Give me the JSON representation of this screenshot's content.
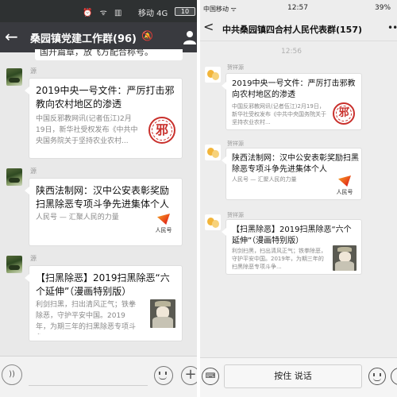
{
  "left": {
    "status": {
      "icons": "⏰ ᯤ ▥",
      "carrier": "移动 4G",
      "battery": "10"
    },
    "nav": {
      "back": "←",
      "title": "桑园镇党建工作群(96)",
      "mute": "🔕"
    },
    "cut_text": "国开篇章，放飞方配合称号。",
    "messages": [
      {
        "sender": "源",
        "title": "2019中央一号文件：严厉打击邪教向农村地区的渗透",
        "desc": "中国反邪教网讯(记者伍江)2月19日，新华社受权发布《中共中央国务院关于坚持农业农村...",
        "thumb": "seal",
        "thumb_text": "邪"
      },
      {
        "sender": "源",
        "title": "陕西法制网：汉中公安表彰奖励扫黑除恶专项斗争先进集体个人",
        "desc": "人民号 — 汇聚人民的力量",
        "thumb": "rmh",
        "thumb_text": "人民号"
      },
      {
        "sender": "源",
        "title": "【扫黑除恶】2019扫黑除恶“六个延伸”（漫画特别版）",
        "desc": "利剑扫黑，扫出清风正气；铁拳除恶，守护平安中国。2019年，为期三年的扫黑除恶专项斗争...",
        "thumb": "comic"
      }
    ],
    "bottom": {
      "voice": "))"
    }
  },
  "right": {
    "status": {
      "carrier": "中国移动 ᯤ",
      "time": "12:57",
      "battery": "39%"
    },
    "nav": {
      "back": "<",
      "title": "中共桑园镇四合村人民代表群(157)",
      "more": "•••"
    },
    "timestamp": "12:56",
    "messages": [
      {
        "sender": "贺祥源",
        "title": "2019中央一号文件：严厉打击邪教向农村地区的渗透",
        "desc": "中国反邪教网讯(记者伍江)2月19日，新华社受权发布《中共中央国务院关于坚持农业农村...",
        "thumb": "seal",
        "thumb_text": "邪"
      },
      {
        "sender": "贺祥源",
        "title": "陕西法制网：汉中公安表彰奖励扫黑除恶专项斗争先进集体个人",
        "desc": "人民号 — 汇聚人民的力量",
        "thumb": "rmh",
        "thumb_text": "人民号"
      },
      {
        "sender": "贺祥源",
        "title": "【扫黑除恶】2019扫黑除恶“六个延伸”（漫画特别版）",
        "desc": "利剑扫黑，扫出清风正气；铁拳除恶，守护平安中国。2019年，为期三年的扫黑除恶专项斗争...",
        "thumb": "comic"
      }
    ],
    "bottom": {
      "kbd": "⌨",
      "talk": "按住 说话"
    }
  }
}
